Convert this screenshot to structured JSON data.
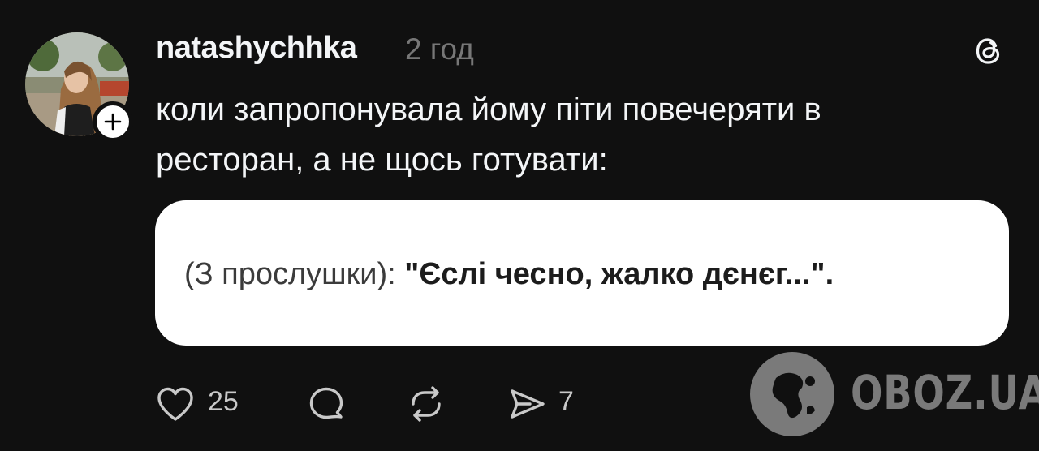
{
  "post": {
    "username": "natashychhka",
    "time": "2 год",
    "text": "коли запропонувала йому піти повечеряти в ресторан, а не щось готувати:"
  },
  "quote": {
    "prefix": "(З прослушки): ",
    "quoted": "\"Єслі чесно, жалко дєнєг...\".",
    "background": "#ffffff"
  },
  "actions": {
    "likes": "25",
    "reposts_icon": "repost-icon",
    "shares": "7"
  },
  "watermark": {
    "text": "OBOZ.UA"
  },
  "colors": {
    "background": "#101010",
    "text": "#f3f5f7",
    "muted": "#777777"
  }
}
